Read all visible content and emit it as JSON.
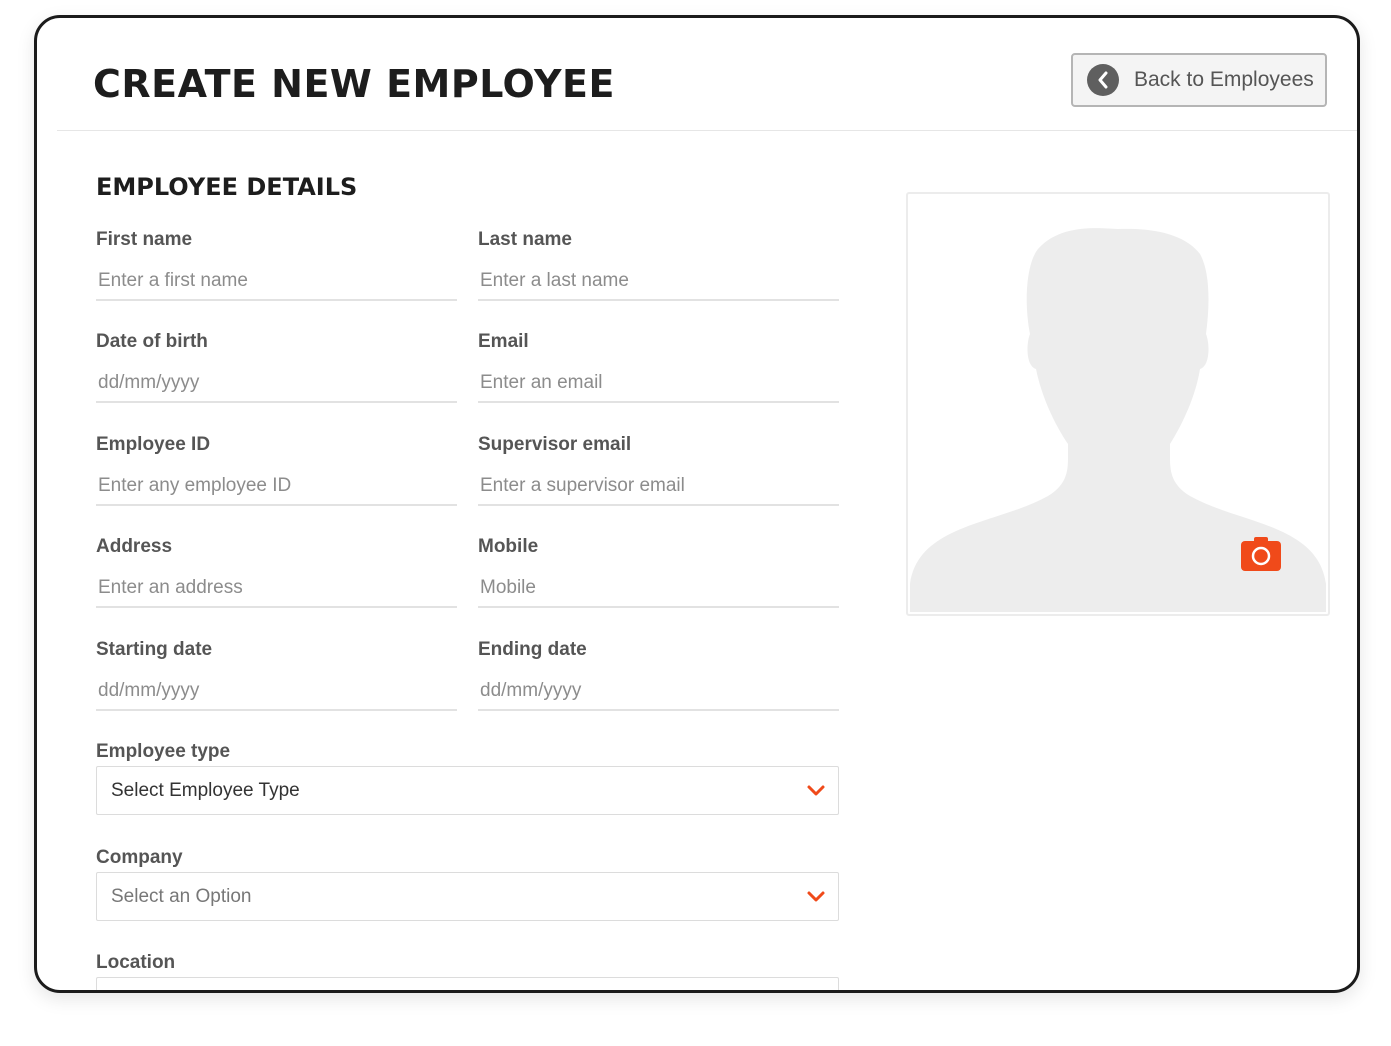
{
  "header": {
    "title": "CREATE NEW EMPLOYEE",
    "back_button_label": "Back to Employees"
  },
  "section": {
    "title": "EMPLOYEE DETAILS"
  },
  "fields": {
    "first_name": {
      "label": "First name",
      "placeholder": "Enter a first name",
      "value": ""
    },
    "last_name": {
      "label": "Last name",
      "placeholder": "Enter a last name",
      "value": ""
    },
    "date_of_birth": {
      "label": "Date of birth",
      "placeholder": "dd/mm/yyyy",
      "value": ""
    },
    "email": {
      "label": "Email",
      "placeholder": "Enter an email",
      "value": ""
    },
    "employee_id": {
      "label": "Employee ID",
      "placeholder": "Enter any employee ID",
      "value": ""
    },
    "supervisor_email": {
      "label": "Supervisor email",
      "placeholder": "Enter a supervisor email",
      "value": ""
    },
    "address": {
      "label": "Address",
      "placeholder": "Enter an address",
      "value": ""
    },
    "mobile": {
      "label": "Mobile",
      "placeholder": "Mobile",
      "value": ""
    },
    "starting_date": {
      "label": "Starting date",
      "placeholder": "dd/mm/yyyy",
      "value": ""
    },
    "ending_date": {
      "label": "Ending date",
      "placeholder": "dd/mm/yyyy",
      "value": ""
    }
  },
  "selects": {
    "employee_type": {
      "label": "Employee type",
      "selected": "Select Employee Type"
    },
    "company": {
      "label": "Company",
      "selected": "Select an Option"
    },
    "location": {
      "label": "Location",
      "selected": ""
    }
  },
  "photo": {
    "icon": "person-silhouette-icon",
    "camera_icon": "camera-icon"
  },
  "colors": {
    "accent": "#f04a1a",
    "silhouette": "#ededed",
    "back_circle": "#5f5f5f",
    "title_text": "#1d1d1d",
    "label_text": "#555555"
  }
}
